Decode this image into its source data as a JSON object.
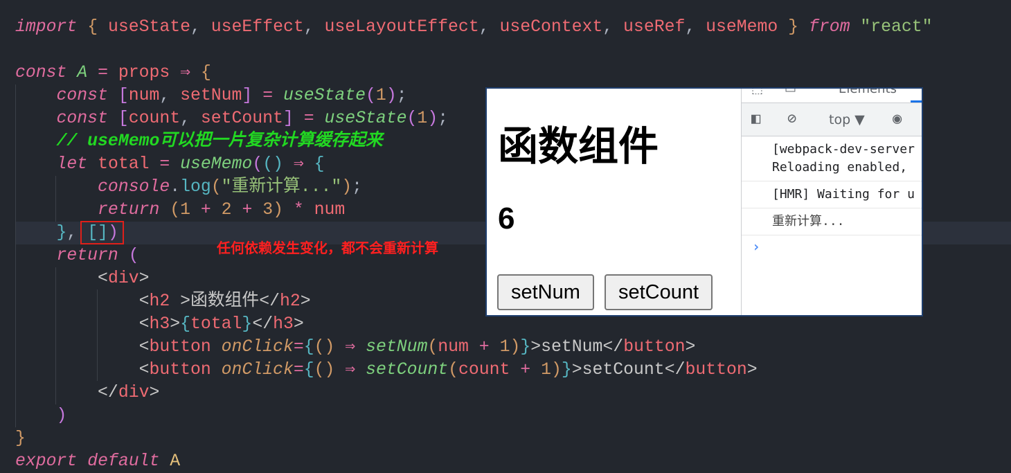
{
  "editor": {
    "lines": [
      [
        [
          "import",
          "k"
        ],
        [
          " ",
          "p"
        ],
        [
          "{",
          "bo"
        ],
        [
          " useState",
          "v"
        ],
        [
          ",",
          "p"
        ],
        [
          " useEffect",
          "v"
        ],
        [
          ",",
          "p"
        ],
        [
          " useLayoutEffect",
          "v"
        ],
        [
          ",",
          "p"
        ],
        [
          " useContext",
          "v"
        ],
        [
          ",",
          "p"
        ],
        [
          " useRef",
          "v"
        ],
        [
          ",",
          "p"
        ],
        [
          " useMemo",
          "v"
        ],
        [
          " ",
          "p"
        ],
        [
          "}",
          "bo"
        ],
        [
          " ",
          "p"
        ],
        [
          "from",
          "k"
        ],
        [
          " ",
          "p"
        ],
        [
          "\"react\"",
          "s"
        ]
      ],
      [],
      [
        [
          "const",
          "k"
        ],
        [
          " ",
          "p"
        ],
        [
          "A",
          "g"
        ],
        [
          " = ",
          "o"
        ],
        [
          "props",
          "v"
        ],
        [
          " ⇒ ",
          "o"
        ],
        [
          "{",
          "bo"
        ]
      ],
      [
        [
          "    ",
          "p"
        ],
        [
          "const",
          "k"
        ],
        [
          " ",
          "p"
        ],
        [
          "[",
          "bp"
        ],
        [
          "num",
          "v"
        ],
        [
          ", ",
          "p"
        ],
        [
          "setNum",
          "v"
        ],
        [
          "]",
          "bp"
        ],
        [
          " = ",
          "o"
        ],
        [
          "useState",
          "f"
        ],
        [
          "(",
          "bp"
        ],
        [
          "1",
          "n"
        ],
        [
          ")",
          "bp"
        ],
        [
          ";",
          "p"
        ]
      ],
      [
        [
          "    ",
          "p"
        ],
        [
          "const",
          "k"
        ],
        [
          " ",
          "p"
        ],
        [
          "[",
          "bp"
        ],
        [
          "count",
          "v"
        ],
        [
          ", ",
          "p"
        ],
        [
          "setCount",
          "v"
        ],
        [
          "]",
          "bp"
        ],
        [
          " = ",
          "o"
        ],
        [
          "useState",
          "f"
        ],
        [
          "(",
          "bp"
        ],
        [
          "1",
          "n"
        ],
        [
          ")",
          "bp"
        ],
        [
          ";",
          "p"
        ]
      ],
      [
        [
          "    ",
          "p"
        ],
        [
          "// useMemo可以把一片复杂计算缓存起来",
          "c"
        ]
      ],
      [
        [
          "    ",
          "p"
        ],
        [
          "let",
          "k"
        ],
        [
          " ",
          "p"
        ],
        [
          "total",
          "v"
        ],
        [
          " = ",
          "o"
        ],
        [
          "useMemo",
          "f"
        ],
        [
          "(",
          "bp"
        ],
        [
          "()",
          "bt"
        ],
        [
          " ⇒ ",
          "o"
        ],
        [
          "{",
          "bt"
        ]
      ],
      [
        [
          "        ",
          "p"
        ],
        [
          "console",
          "k"
        ],
        [
          ".",
          "p"
        ],
        [
          "log",
          "bt"
        ],
        [
          "(",
          "bo"
        ],
        [
          "\"重新计算...\"",
          "s"
        ],
        [
          ")",
          "bo"
        ],
        [
          ";",
          "p"
        ]
      ],
      [
        [
          "        ",
          "p"
        ],
        [
          "return",
          "k"
        ],
        [
          " ",
          "p"
        ],
        [
          "(",
          "bo"
        ],
        [
          "1",
          "n"
        ],
        [
          " + ",
          "o"
        ],
        [
          "2",
          "n"
        ],
        [
          " + ",
          "o"
        ],
        [
          "3",
          "n"
        ],
        [
          ")",
          "bo"
        ],
        [
          " * ",
          "o"
        ],
        [
          "num",
          "v"
        ]
      ],
      [
        [
          "    ",
          "p"
        ],
        [
          "}",
          "bt"
        ],
        [
          ", ",
          "p"
        ],
        [
          "[]",
          "bt"
        ],
        [
          ")",
          "bp"
        ]
      ],
      [
        [
          "    ",
          "p"
        ],
        [
          "return",
          "k"
        ],
        [
          " ",
          "p"
        ],
        [
          "(",
          "bp"
        ]
      ],
      [
        [
          "        ",
          "p"
        ],
        [
          "<",
          "w"
        ],
        [
          "div",
          "t"
        ],
        [
          ">",
          "w"
        ]
      ],
      [
        [
          "            ",
          "p"
        ],
        [
          "<",
          "w"
        ],
        [
          "h2",
          "t"
        ],
        [
          " >",
          "w"
        ],
        [
          "函数组件",
          "w"
        ],
        [
          "</",
          "w"
        ],
        [
          "h2",
          "t"
        ],
        [
          ">",
          "w"
        ]
      ],
      [
        [
          "            ",
          "p"
        ],
        [
          "<",
          "w"
        ],
        [
          "h3",
          "t"
        ],
        [
          ">",
          "w"
        ],
        [
          "{",
          "bt"
        ],
        [
          "total",
          "v"
        ],
        [
          "}",
          "bt"
        ],
        [
          "</",
          "w"
        ],
        [
          "h3",
          "t"
        ],
        [
          ">",
          "w"
        ]
      ],
      [
        [
          "            ",
          "p"
        ],
        [
          "<",
          "w"
        ],
        [
          "button",
          "t"
        ],
        [
          " ",
          "p"
        ],
        [
          "onClick",
          "a"
        ],
        [
          "=",
          "o"
        ],
        [
          "{",
          "bt"
        ],
        [
          "()",
          "bo"
        ],
        [
          " ⇒ ",
          "o"
        ],
        [
          "setNum",
          "f"
        ],
        [
          "(",
          "bo"
        ],
        [
          "num",
          "v"
        ],
        [
          " + ",
          "o"
        ],
        [
          "1",
          "n"
        ],
        [
          ")",
          "bo"
        ],
        [
          "}",
          "bt"
        ],
        [
          ">setNum",
          "w"
        ],
        [
          "</",
          "w"
        ],
        [
          "button",
          "t"
        ],
        [
          ">",
          "w"
        ]
      ],
      [
        [
          "            ",
          "p"
        ],
        [
          "<",
          "w"
        ],
        [
          "button",
          "t"
        ],
        [
          " ",
          "p"
        ],
        [
          "onClick",
          "a"
        ],
        [
          "=",
          "o"
        ],
        [
          "{",
          "bt"
        ],
        [
          "()",
          "bo"
        ],
        [
          " ⇒ ",
          "o"
        ],
        [
          "setCount",
          "f"
        ],
        [
          "(",
          "bo"
        ],
        [
          "count",
          "v"
        ],
        [
          " + ",
          "o"
        ],
        [
          "1",
          "n"
        ],
        [
          ")",
          "bo"
        ],
        [
          "}",
          "bt"
        ],
        [
          ">setCount",
          "w"
        ],
        [
          "</",
          "w"
        ],
        [
          "button",
          "t"
        ],
        [
          ">",
          "w"
        ]
      ],
      [
        [
          "        ",
          "p"
        ],
        [
          "</",
          "w"
        ],
        [
          "div",
          "t"
        ],
        [
          ">",
          "w"
        ]
      ],
      [
        [
          "    ",
          "p"
        ],
        [
          ")",
          "bp"
        ]
      ],
      [
        [
          "}",
          "bo"
        ]
      ],
      [
        [
          "export",
          "k"
        ],
        [
          " ",
          "p"
        ],
        [
          "default",
          "k"
        ],
        [
          " ",
          "p"
        ],
        [
          "A",
          "y"
        ]
      ]
    ],
    "annotation": "任何依赖发生变化，都不会重新计算"
  },
  "browser": {
    "heading": "函数组件",
    "total": "6",
    "buttons": [
      "setNum",
      "setCount"
    ]
  },
  "devtools": {
    "tab": "Elements",
    "context": "top ▼",
    "messages": [
      "[webpack-dev-server\nReloading enabled,",
      "[HMR] Waiting for u",
      "重新计算..."
    ]
  },
  "colors": {
    "accent": "#1a73e8",
    "annotation": "#ff2020"
  }
}
